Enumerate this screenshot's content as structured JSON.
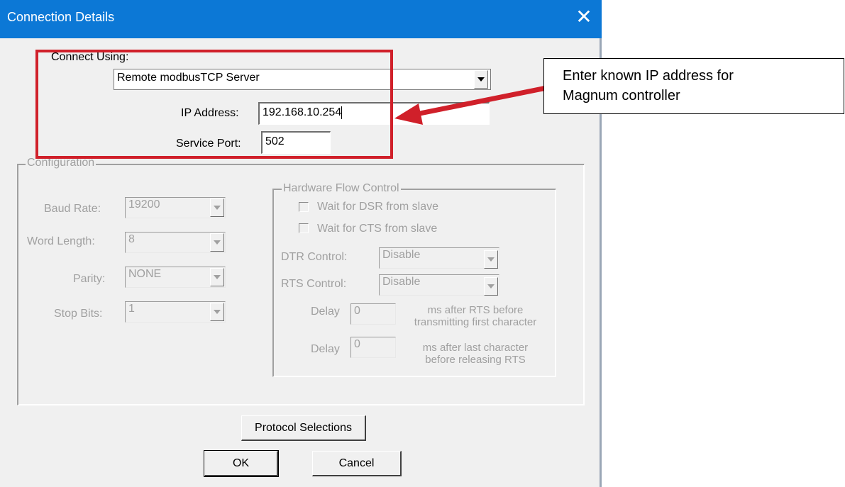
{
  "window": {
    "title": "Connection Details",
    "close_glyph": "✕"
  },
  "connect": {
    "label": "Connect Using:",
    "selected": "Remote modbusTCP Server",
    "ip_label": "IP Address:",
    "ip_value": "192.168.10.254",
    "port_label": "Service Port:",
    "port_value": "502"
  },
  "configuration": {
    "label": "Configuration",
    "baud_label": "Baud Rate:",
    "baud_value": "19200",
    "word_label": "Word Length:",
    "word_value": "8",
    "parity_label": "Parity:",
    "parity_value": "NONE",
    "stop_label": "Stop Bits:",
    "stop_value": "1"
  },
  "hardware_flow": {
    "label": "Hardware Flow Control",
    "dsr_label": "Wait for DSR from slave",
    "cts_label": "Wait for CTS from slave",
    "dtr_label": "DTR Control:",
    "dtr_value": "Disable",
    "rts_label": "RTS Control:",
    "rts_value": "Disable",
    "delay1_label": "Delay",
    "delay1_value": "0",
    "delay1_desc_line1": "ms after RTS before",
    "delay1_desc_line2": "transmitting first character",
    "delay2_label": "Delay",
    "delay2_value": "0",
    "delay2_desc_line1": "ms after last character",
    "delay2_desc_line2": "before releasing RTS"
  },
  "buttons": {
    "protocol": "Protocol Selections",
    "ok": "OK",
    "cancel": "Cancel"
  },
  "annotation": {
    "line1": "Enter known IP address for",
    "line2": "Magnum controller",
    "color": "#d0202a"
  }
}
